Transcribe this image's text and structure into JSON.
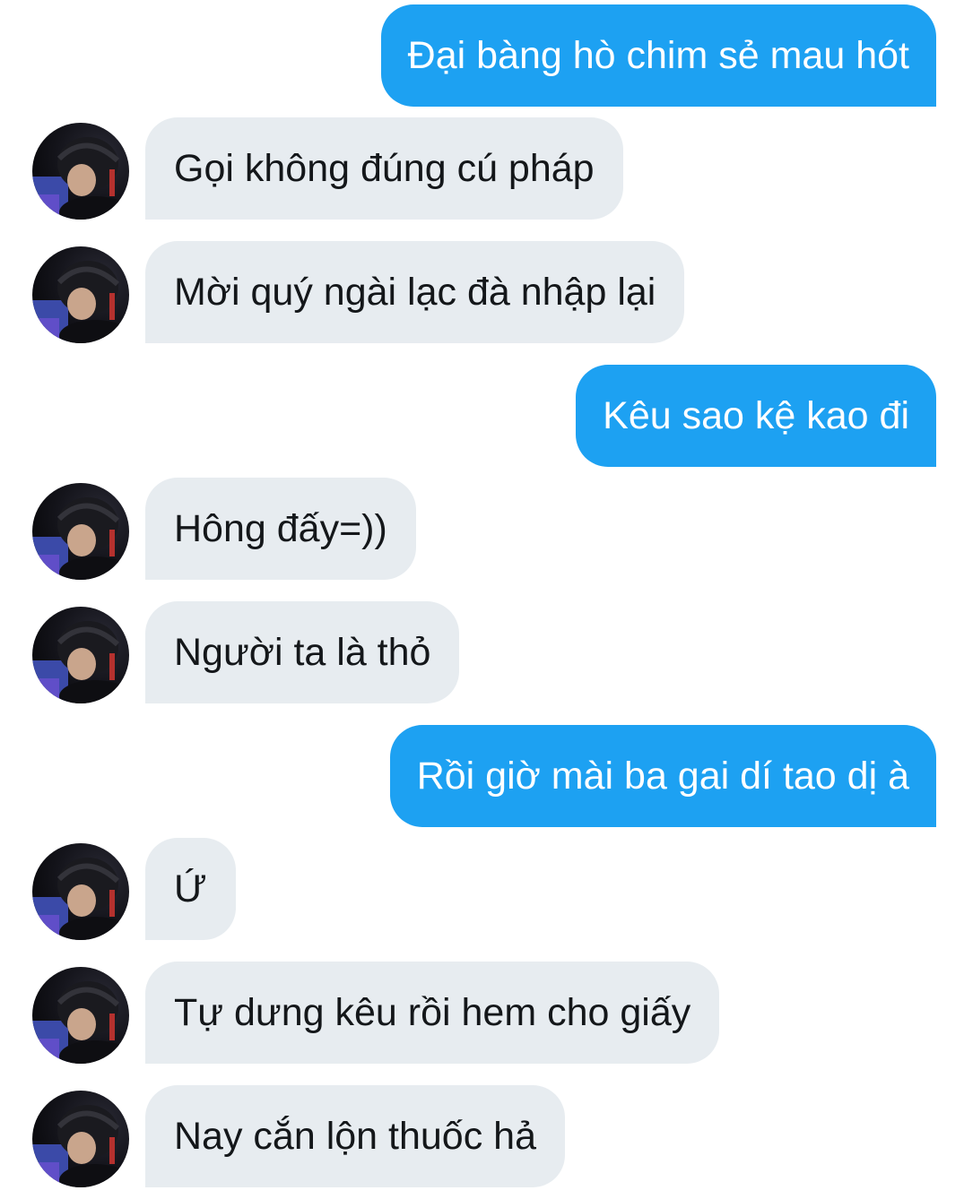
{
  "conversation": {
    "messages": [
      {
        "sender": "me",
        "text": "Đại bàng hò chim sẻ mau hót"
      },
      {
        "sender": "them",
        "text": "Gọi không đúng cú pháp"
      },
      {
        "sender": "them",
        "text": "Mời quý ngài lạc đà nhập lại"
      },
      {
        "sender": "me",
        "text": "Kêu sao kệ kao đi"
      },
      {
        "sender": "them",
        "text": "Hông đấy=))"
      },
      {
        "sender": "them",
        "text": "Người ta là thỏ"
      },
      {
        "sender": "me",
        "text": "Rồi giờ mài ba gai dí tao dị à"
      },
      {
        "sender": "them",
        "text": "Ứ"
      },
      {
        "sender": "them",
        "text": "Tự dưng kêu rồi hem cho giấy"
      },
      {
        "sender": "them",
        "text": "Nay cắn lộn thuốc hả"
      }
    ]
  },
  "colors": {
    "sent_bubble": "#1da1f2",
    "received_bubble": "#e7ecf0",
    "sent_text": "#ffffff",
    "received_text": "#14171a"
  }
}
